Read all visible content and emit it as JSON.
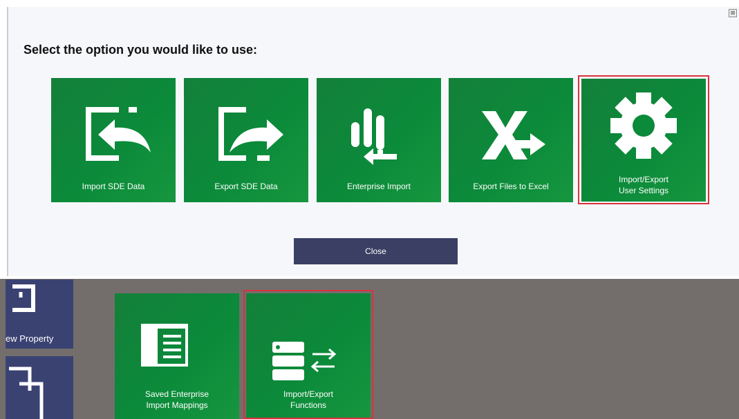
{
  "dialog": {
    "prompt": "Select the option you would like to use:",
    "tiles": [
      {
        "label": "Import SDE Data",
        "icon": "import-arrow-icon"
      },
      {
        "label": "Export SDE Data",
        "icon": "export-arrow-icon"
      },
      {
        "label": "Enterprise Import",
        "icon": "enterprise-import-icon"
      },
      {
        "label": "Export Files to Excel",
        "icon": "excel-export-icon"
      },
      {
        "label": "Import/Export\nUser Settings",
        "icon": "gear-icon",
        "selected": true
      }
    ],
    "close_label": "Close",
    "window_close_glyph": "⊠"
  },
  "background": {
    "left_tiles": [
      {
        "label": "ew Property"
      },
      {
        "label": ""
      }
    ],
    "tiles": [
      {
        "label": "Saved Enterprise\nImport Mappings",
        "icon": "document-list-icon"
      },
      {
        "label": "Import/Export\nFunctions",
        "icon": "server-transfer-icon",
        "selected": true
      }
    ]
  },
  "colors": {
    "tile_green": "#0b8a3a",
    "close_button": "#3a3f63",
    "background_area": "#736e6c",
    "navy_tile": "#3a4272",
    "selection_outline": "#d8323a"
  }
}
